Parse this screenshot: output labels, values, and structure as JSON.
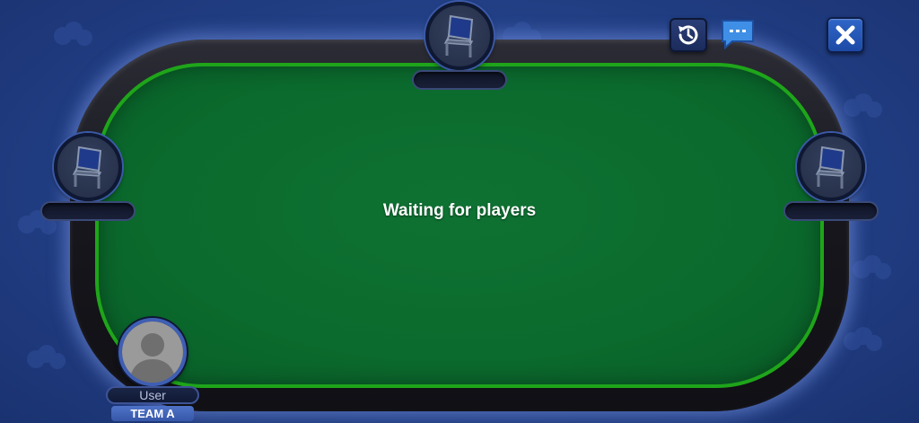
{
  "table": {
    "status": "Waiting for players"
  },
  "seats": [
    {
      "position": "top",
      "state": "empty",
      "icon": "empty-chair-icon"
    },
    {
      "position": "left",
      "state": "empty",
      "icon": "empty-chair-icon"
    },
    {
      "position": "right",
      "state": "empty",
      "icon": "empty-chair-icon"
    }
  ],
  "player": {
    "name": "User",
    "team": "TEAM A",
    "avatar": "default-avatar-icon"
  },
  "toolbar": {
    "history_icon": "history-icon",
    "chat_icon": "chat-icon",
    "close_icon": "close-icon"
  },
  "colors": {
    "felt": "#0b6a2d",
    "felt_border": "#1fa51a",
    "background": "#223f85",
    "close_button": "#2f66c8",
    "team_badge": "#4f73c8"
  }
}
